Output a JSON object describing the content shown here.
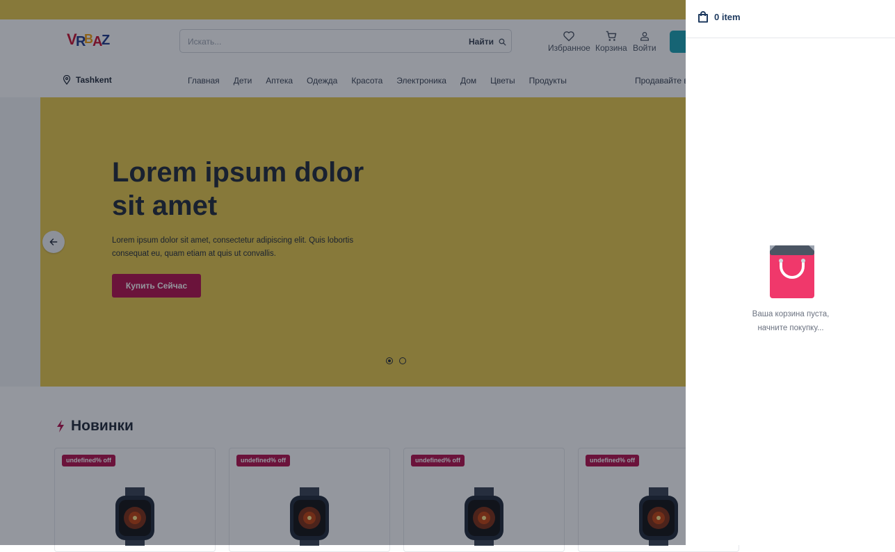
{
  "header": {
    "logo_text": "VRBAZ",
    "search_placeholder": "Искать...",
    "search_button": "Найти",
    "favorites_label": "Избранное",
    "cart_label": "Корзина",
    "login_label": "Войти"
  },
  "nav": {
    "location": "Tashkent",
    "items": [
      "Главная",
      "Дети",
      "Аптека",
      "Одежда",
      "Красота",
      "Электроника",
      "Дом",
      "Цветы",
      "Продукты"
    ],
    "sell_label": "Продавайте в"
  },
  "hero": {
    "title": "Lorem ipsum dolor sit amet",
    "description": "Lorem ipsum dolor sit amet, consectetur adipiscing elit. Quis lobortis consequat eu, quam etiam at quis ut convallis.",
    "button": "Купить Сейчас",
    "slides": 2,
    "active_slide": 1
  },
  "new_products": {
    "title": "Новинки",
    "cards": [
      {
        "badge": "undefined% off",
        "image": "smartwatch"
      },
      {
        "badge": "undefined% off",
        "image": "smartwatch"
      },
      {
        "badge": "undefined% off",
        "image": "smartwatch"
      },
      {
        "badge": "undefined% off",
        "image": "smartwatch"
      }
    ]
  },
  "cart": {
    "count_label": "0 item",
    "empty_line1": "Ваша корзина пуста,",
    "empty_line2": "начните покупку..."
  },
  "colors": {
    "brand_yellow": "#e8c84a",
    "brand_crimson": "#b5104b",
    "accent_teal": "#1aa3b3",
    "bag_pink": "#f0386b"
  }
}
